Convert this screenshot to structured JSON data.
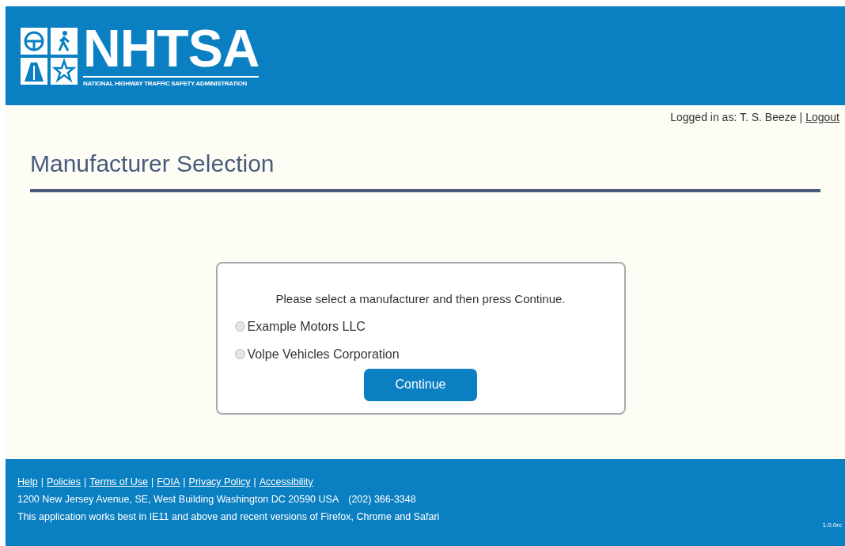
{
  "header": {
    "logo": {
      "name": "NHTSA",
      "subtitle": "NATIONAL HIGHWAY TRAFFIC SAFETY ADMINISTRATION"
    }
  },
  "user_bar": {
    "label": "Logged in as: T. S. Beeze",
    "separator": "|",
    "logout": "Logout"
  },
  "page": {
    "title": "Manufacturer Selection"
  },
  "form": {
    "prompt": "Please select a manufacturer and then press Continue.",
    "options": [
      {
        "label": "Example Motors LLC",
        "selected": false
      },
      {
        "label": "Volpe Vehicles Corporation",
        "selected": false
      }
    ],
    "button": "Continue"
  },
  "footer": {
    "links": [
      "Help",
      "Policies",
      "Terms of Use",
      "FOIA",
      "Privacy Policy",
      "Accessibility"
    ],
    "separator": "|",
    "address": "1200 New Jersey Avenue, SE, West Building Washington DC 20590 USA",
    "phone": "(202) 366-3348",
    "note": "This application works best in IE11 and above and recent versions of Firefox, Chrome and Safari",
    "version": "1.0.0rc"
  }
}
